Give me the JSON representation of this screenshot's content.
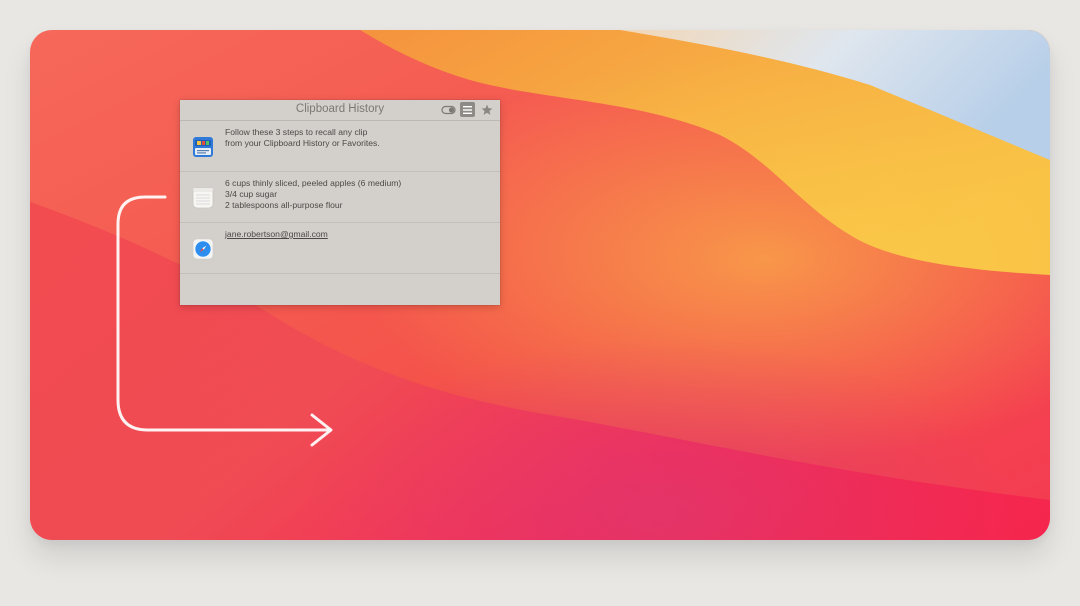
{
  "window": {
    "title": "Clipboard History",
    "icons": [
      "toggle-icon",
      "list-icon",
      "star-icon"
    ]
  },
  "clips": [
    {
      "icon": "clipboard-app-icon",
      "lines": [
        "Follow these 3 steps to recall any clip",
        "from your Clipboard History or Favorites."
      ]
    },
    {
      "icon": "notes-icon",
      "lines": [
        "6 cups thinly sliced, peeled apples (6 medium)",
        "3/4 cup sugar",
        "2 tablespoons all-purpose flour"
      ]
    },
    {
      "icon": "safari-icon",
      "lines": [
        "jane.robertson@gmail.com"
      ]
    }
  ],
  "colors": {
    "wallpaper_red": "#f2474f",
    "wallpaper_orange": "#f7a13d",
    "wallpaper_sky": "#c3d6ea",
    "panel_bg": "#d3cfcb"
  }
}
